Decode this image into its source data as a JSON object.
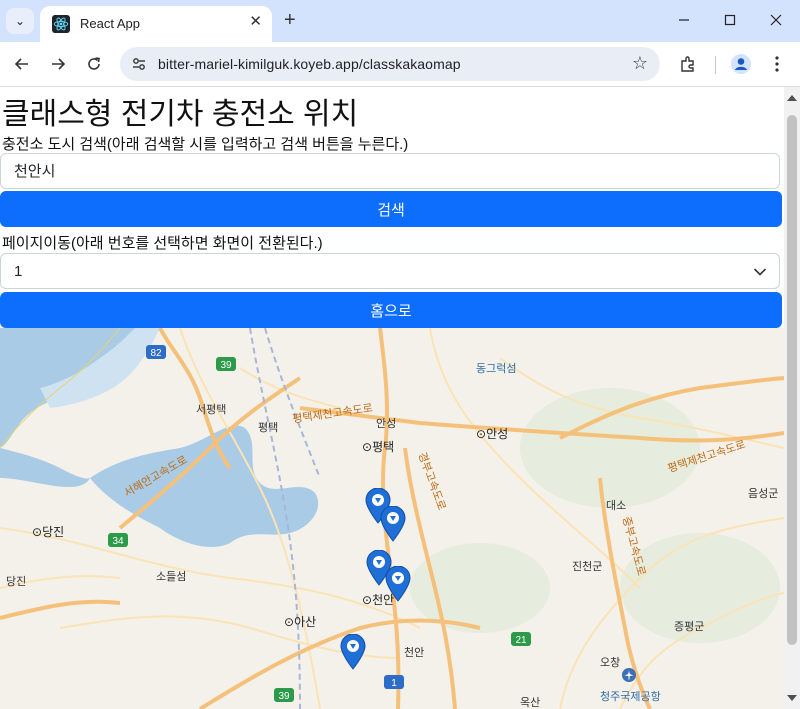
{
  "browser": {
    "tab_title": "React App",
    "url": "bitter-mariel-kimilguk.koyeb.app/classkakaomap"
  },
  "page": {
    "title": "클래스형 전기차 충전소 위치",
    "search_label": "충전소 도시 검색(아래 검색할 시를 입력하고 검색 버튼을 누른다.)",
    "search_value": "천안시",
    "search_button": "검색",
    "page_label": "페이지이동(아래 번호를 선택하면 화면이 전환된다.)",
    "page_selected": "1",
    "home_button": "홈으로"
  },
  "map": {
    "place_labels": [
      "동그럭섬",
      "서평택",
      "평택",
      "안성",
      "평택",
      "안성",
      "평택제천고속도로",
      "서해안고속도로",
      "경부고속도로",
      "평택제천고속도로",
      "대소",
      "음성군",
      "당진",
      "당진",
      "소들섬",
      "진천군",
      "아산",
      "천안",
      "천안",
      "증평군",
      "오창",
      "청주국제공항",
      "옥산",
      "중부고속도로"
    ],
    "road_numbers": [
      "82",
      "39",
      "34",
      "21",
      "1",
      "39"
    ],
    "colors": {
      "water": "#a9cbe6",
      "land": "#f3f1ea",
      "road_major": "#f5c17a",
      "road_minor": "#ffffff",
      "marker": "#1f6fd6"
    }
  }
}
